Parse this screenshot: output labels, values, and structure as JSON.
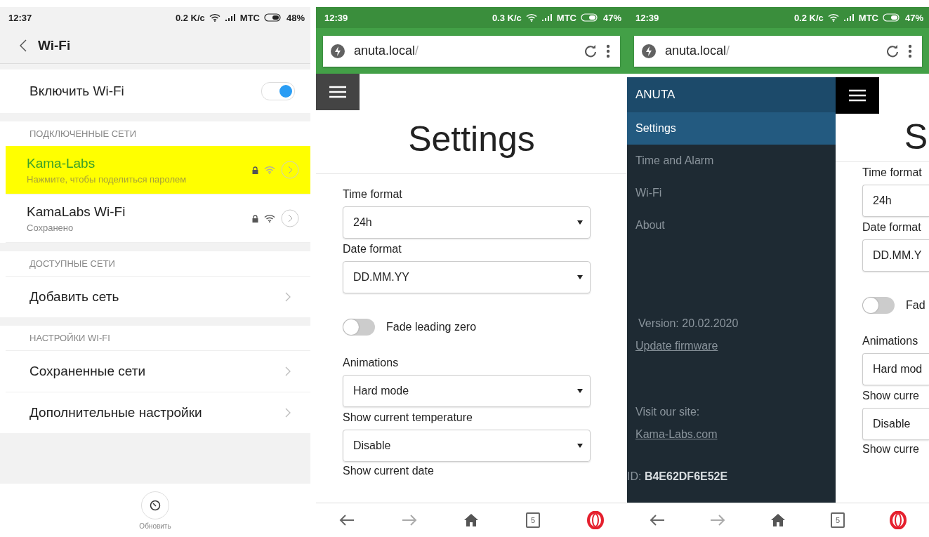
{
  "wifi_screen": {
    "status_bar": {
      "time": "12:37",
      "speed": "0.2 K/c",
      "carrier": "MTC",
      "battery": "48%"
    },
    "title": "Wi-Fi",
    "wifi_toggle": {
      "label": "Включить Wi-Fi",
      "on": true
    },
    "sections": [
      {
        "header": "ПОДКЛЮЧЕННЫЕ СЕТИ",
        "items": [
          {
            "kind": "network",
            "name": "Kama-Labs",
            "subtitle": "Нажмите, чтобы поделиться паролем",
            "selected": true
          },
          {
            "kind": "network",
            "name": "KamaLabs Wi-Fi",
            "subtitle": "Сохранено",
            "selected": false
          }
        ]
      },
      {
        "header": "ДОСТУПНЫЕ СЕТИ",
        "items": [
          {
            "kind": "link",
            "name": "Добавить сеть"
          }
        ]
      },
      {
        "header": "НАСТРОЙКИ WI-FI",
        "items": [
          {
            "kind": "link",
            "name": "Сохраненные сети"
          },
          {
            "kind": "link",
            "name": "Дополнительные настройки"
          }
        ]
      }
    ],
    "refresh_label": "Обновить"
  },
  "browser_settings": {
    "status_bar": {
      "time": "12:39",
      "speed": "0.3 K/c",
      "carrier": "MTC",
      "battery": "47%"
    },
    "url": "anuta.local",
    "url_slash": "/",
    "heading": "Settings",
    "fields": [
      {
        "kind": "select",
        "label": "Time format",
        "value": "24h"
      },
      {
        "kind": "select",
        "label": "Date format",
        "value": "DD.MM.YY"
      },
      {
        "kind": "toggle",
        "label": "Fade leading zero",
        "on": false
      },
      {
        "kind": "select",
        "label": "Animations",
        "value": "Hard mode"
      },
      {
        "kind": "select",
        "label": "Show current temperature",
        "value": "Disable"
      },
      {
        "kind": "label",
        "label": "Show current date"
      }
    ],
    "tab_count": "5"
  },
  "browser_menu": {
    "status_bar": {
      "time": "12:39",
      "speed": "0.2 K/c",
      "carrier": "MTC",
      "battery": "47%"
    },
    "url": "anuta.local",
    "url_slash": "/",
    "sidebar": {
      "brand": "ANUTA",
      "items": [
        {
          "label": "Settings",
          "selected": true
        },
        {
          "label": "Time and Alarm",
          "selected": false
        },
        {
          "label": "Wi-Fi",
          "selected": false
        },
        {
          "label": "About",
          "selected": false
        }
      ],
      "version": "Version: 20.02.2020",
      "update_link": "Update firmware",
      "visit_label": "Visit our site:",
      "site_link": "Kama-Labs.com",
      "device_id": "ID: **B4E62DF6E52E**"
    },
    "heading": "S",
    "fields": [
      {
        "kind": "select",
        "label": "Time format",
        "value": "24h"
      },
      {
        "kind": "select",
        "label": "Date format",
        "value": "DD.MM.Y"
      },
      {
        "kind": "toggle",
        "label": "Fad",
        "on": false
      },
      {
        "kind": "select",
        "label": "Animations",
        "value": "Hard mod"
      },
      {
        "kind": "select",
        "label": "Show curre",
        "value": "Disable"
      },
      {
        "kind": "label",
        "label": "Show curre"
      }
    ],
    "tab_count": "5"
  }
}
